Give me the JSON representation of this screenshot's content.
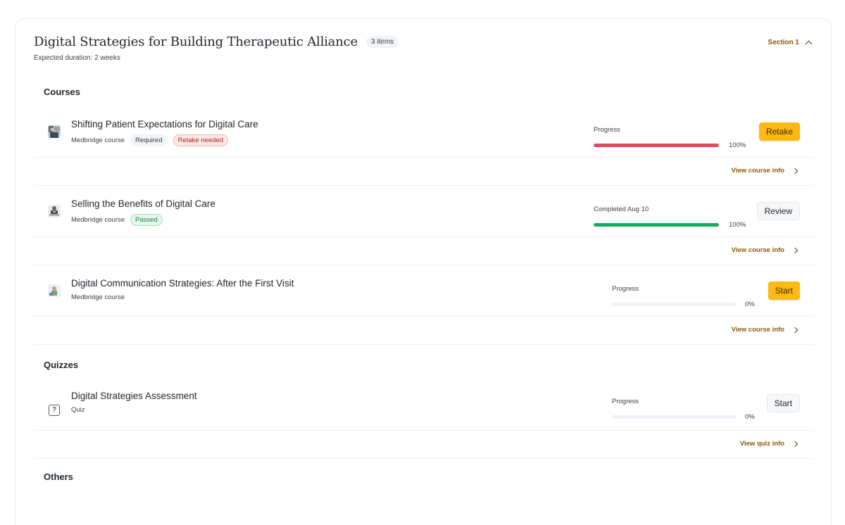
{
  "section": {
    "title": "Digital Strategies for Building Therapeutic Alliance",
    "count_badge": "3 items",
    "duration": "Expected duration: 2 weeks",
    "toggle_label": "Section 1"
  },
  "groups": {
    "courses": "Courses",
    "quizzes": "Quizzes",
    "others": "Others"
  },
  "courses": [
    {
      "name": "Shifting Patient Expectations for Digital Care",
      "type": "Medbridge course",
      "tags": [
        "Required",
        "Retake needed"
      ],
      "progress_label": "Progress",
      "progress": 100,
      "progress_text": "100%",
      "bar_color": "#e5485f",
      "button": "Retake",
      "info_link": "View course info"
    },
    {
      "name": "Selling the Benefits of Digital Care",
      "type": "Medbridge course",
      "tags": [
        "Passed"
      ],
      "progress_label": "Completed Aug 10",
      "progress": 100,
      "progress_text": "100%",
      "bar_color": "#1aa85a",
      "button": "Review",
      "info_link": "View course info"
    },
    {
      "name": "Digital Communication Strategies: After the First Visit",
      "type": "Medbridge course",
      "tags": [],
      "progress_label": "Progress",
      "progress": 0,
      "progress_text": "0%",
      "bar_color": "#eef1f5",
      "button": "Start",
      "info_link": "View course info"
    }
  ],
  "quizzes": [
    {
      "name": "Digital Strategies Assessment",
      "type": "Quiz",
      "icon": "question-icon",
      "progress_label": "Progress",
      "progress": 0,
      "progress_text": "0%",
      "button": "Start",
      "info_link": "View quiz info"
    }
  ],
  "colors": {
    "accent": "#fcb912",
    "link": "#8a5a00",
    "danger": "#e5485f",
    "success": "#1aa85a"
  }
}
